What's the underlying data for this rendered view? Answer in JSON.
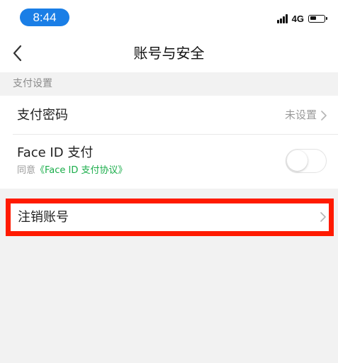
{
  "status_bar": {
    "time": "8:44",
    "network": "4G",
    "battery_level": 0.45
  },
  "nav": {
    "title": "账号与安全",
    "back_icon": "chevron-left-icon"
  },
  "section": {
    "header": "支付设置"
  },
  "settings": {
    "payment_password": {
      "label": "支付密码",
      "value": "未设置"
    },
    "face_id": {
      "label": "Face ID 支付",
      "agree_prefix": "同意",
      "agreement_link": "《Face ID 支付协议》",
      "enabled": false
    },
    "cancel_account": {
      "label": "注销账号"
    }
  },
  "colors": {
    "time_pill": "#1a7ee6",
    "link_green": "#1aad4a",
    "highlight_red": "#ff1a00",
    "background": "#f2f2f2"
  }
}
